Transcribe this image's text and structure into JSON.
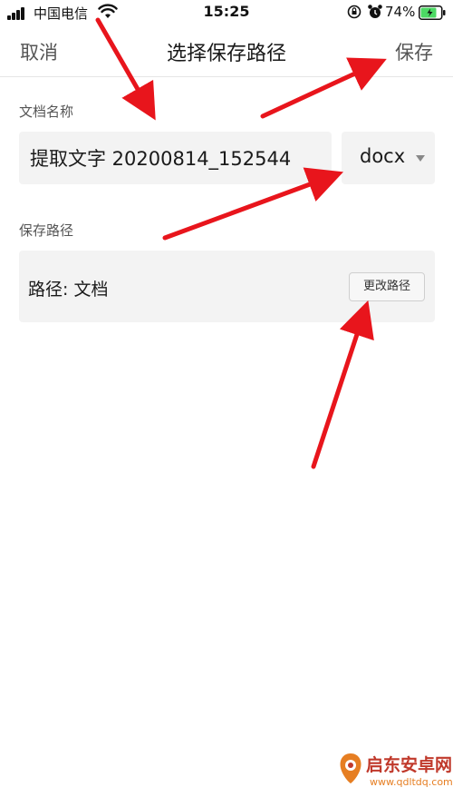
{
  "status_bar": {
    "carrier": "中国电信",
    "time": "15:25",
    "battery_percent": "74%",
    "icons": [
      "signal-icon",
      "wifi-icon",
      "rotation-lock-icon",
      "alarm-icon",
      "battery-icon"
    ]
  },
  "nav": {
    "cancel_label": "取消",
    "title": "选择保存路径",
    "save_label": "保存"
  },
  "file": {
    "section_label": "文档名称",
    "filename_value": "提取文字 20200814_152544",
    "extension_value": "docx",
    "extension_icon": "caret-down-icon"
  },
  "path": {
    "section_label": "保存路径",
    "path_text": "路径: 文档",
    "change_button_label": "更改路径"
  },
  "watermark": {
    "title": "启东安卓网",
    "url": "www.qdltdq.com"
  },
  "colors": {
    "arrow": "#e8151c",
    "field_background": "#f3f3f3",
    "text_primary": "#1a1a1a",
    "text_secondary": "#555555",
    "watermark_red": "#c0392b",
    "watermark_orange": "#e67e22"
  }
}
